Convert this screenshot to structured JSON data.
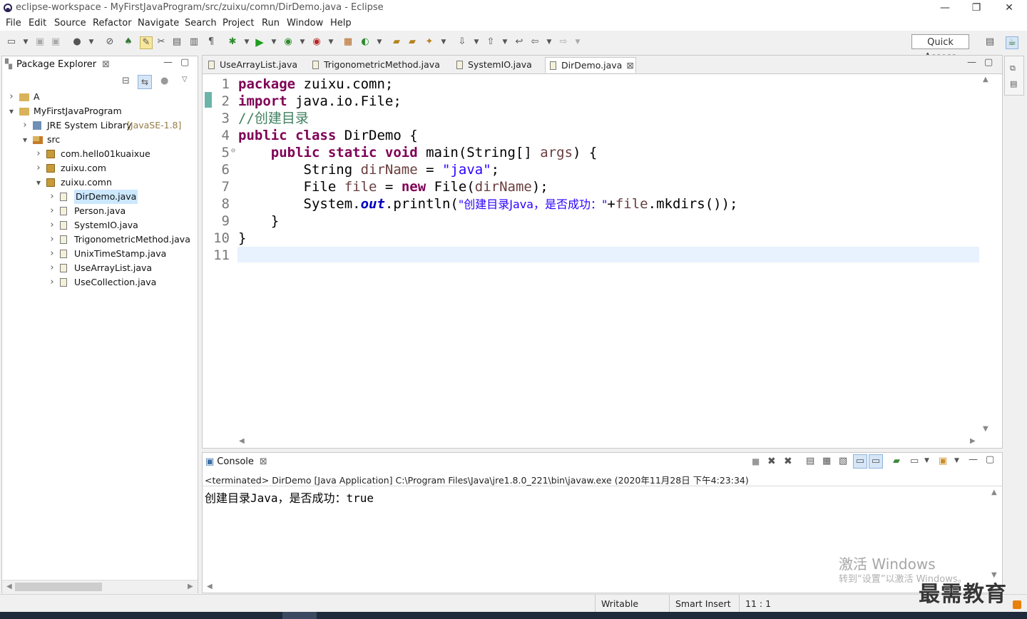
{
  "window": {
    "title": "eclipse-workspace - MyFirstJavaProgram/src/zuixu/comn/DirDemo.java - Eclipse",
    "minimize": "—",
    "restore": "❐",
    "close": "✕"
  },
  "menu": [
    "File",
    "Edit",
    "Source",
    "Refactor",
    "Navigate",
    "Search",
    "Project",
    "Run",
    "Window",
    "Help"
  ],
  "toolbar": {
    "quick_access": "Quick Access"
  },
  "package_explorer": {
    "title": "Package Explorer",
    "tree": [
      {
        "label": "A",
        "expanded": false,
        "indent": 0
      },
      {
        "label": "MyFirstJavaProgram",
        "expanded": true,
        "indent": 0
      },
      {
        "label": "JRE System Library",
        "suffix": "[JavaSE-1.8]",
        "expanded": false,
        "indent": 1
      },
      {
        "label": "src",
        "expanded": true,
        "indent": 1
      },
      {
        "label": "com.hello01kuaixue",
        "expanded": false,
        "indent": 2
      },
      {
        "label": "zuixu.com",
        "expanded": false,
        "indent": 2
      },
      {
        "label": "zuixu.comn",
        "expanded": true,
        "indent": 2
      },
      {
        "label": "DirDemo.java",
        "expanded": false,
        "indent": 3,
        "selected": true
      },
      {
        "label": "Person.java",
        "expanded": false,
        "indent": 3
      },
      {
        "label": "SystemIO.java",
        "expanded": false,
        "indent": 3
      },
      {
        "label": "TrigonometricMethod.java",
        "expanded": false,
        "indent": 3
      },
      {
        "label": "UnixTimeStamp.java",
        "expanded": false,
        "indent": 3
      },
      {
        "label": "UseArrayList.java",
        "expanded": false,
        "indent": 3
      },
      {
        "label": "UseCollection.java",
        "expanded": false,
        "indent": 3
      }
    ]
  },
  "editor": {
    "tabs": [
      {
        "label": "UseArrayList.java",
        "active": false
      },
      {
        "label": "TrigonometricMethod.java",
        "active": false
      },
      {
        "label": "SystemIO.java",
        "active": false
      },
      {
        "label": "DirDemo.java",
        "active": true
      }
    ],
    "line_numbers": [
      "1",
      "2",
      "3",
      "4",
      "5",
      "6",
      "7",
      "8",
      "9",
      "10",
      "11"
    ],
    "code": {
      "l1_kw": "package",
      "l1_rest": " zuixu.comn;",
      "l2_kw": "import",
      "l2_rest": " java.io.File;",
      "l3_comment": "//创建目录",
      "l4_kw": "public class",
      "l4_rest": " DirDemo {",
      "l5_indent": "    ",
      "l5_kw": "public static void",
      "l5_mid": " main(String[] ",
      "l5_var": "args",
      "l5_end": ") {",
      "l6_pre": "        String ",
      "l6_var": "dirName",
      "l6_eq": " = ",
      "l6_str": "\"java\"",
      "l6_end": ";",
      "l7_pre": "        File ",
      "l7_var": "file",
      "l7_eq": " = ",
      "l7_kw": "new",
      "l7_mid": " File(",
      "l7_arg": "dirName",
      "l7_end": ");",
      "l8_pre": "        System.",
      "l8_fld": "out",
      "l8_mid": ".println(",
      "l8_str": "\"创建目录Java，是否成功：\"",
      "l8_plus": "+",
      "l8_var": "file",
      "l8_end": ".mkdirs());",
      "l9": "    }",
      "l10": "}",
      "l11": ""
    }
  },
  "console": {
    "title": "Console",
    "status": "<terminated> DirDemo [Java Application] C:\\Program Files\\Java\\jre1.8.0_221\\bin\\javaw.exe (2020年11月28日 下午4:23:34)",
    "output": "创建目录Java，是否成功：true"
  },
  "statusbar": {
    "writable": "Writable",
    "insert_mode": "Smart Insert",
    "position": "11 : 1"
  },
  "watermark": {
    "line1": "激活 Windows",
    "line2": "转到“设置”以激活 Windows。",
    "brand": "最需教育"
  }
}
